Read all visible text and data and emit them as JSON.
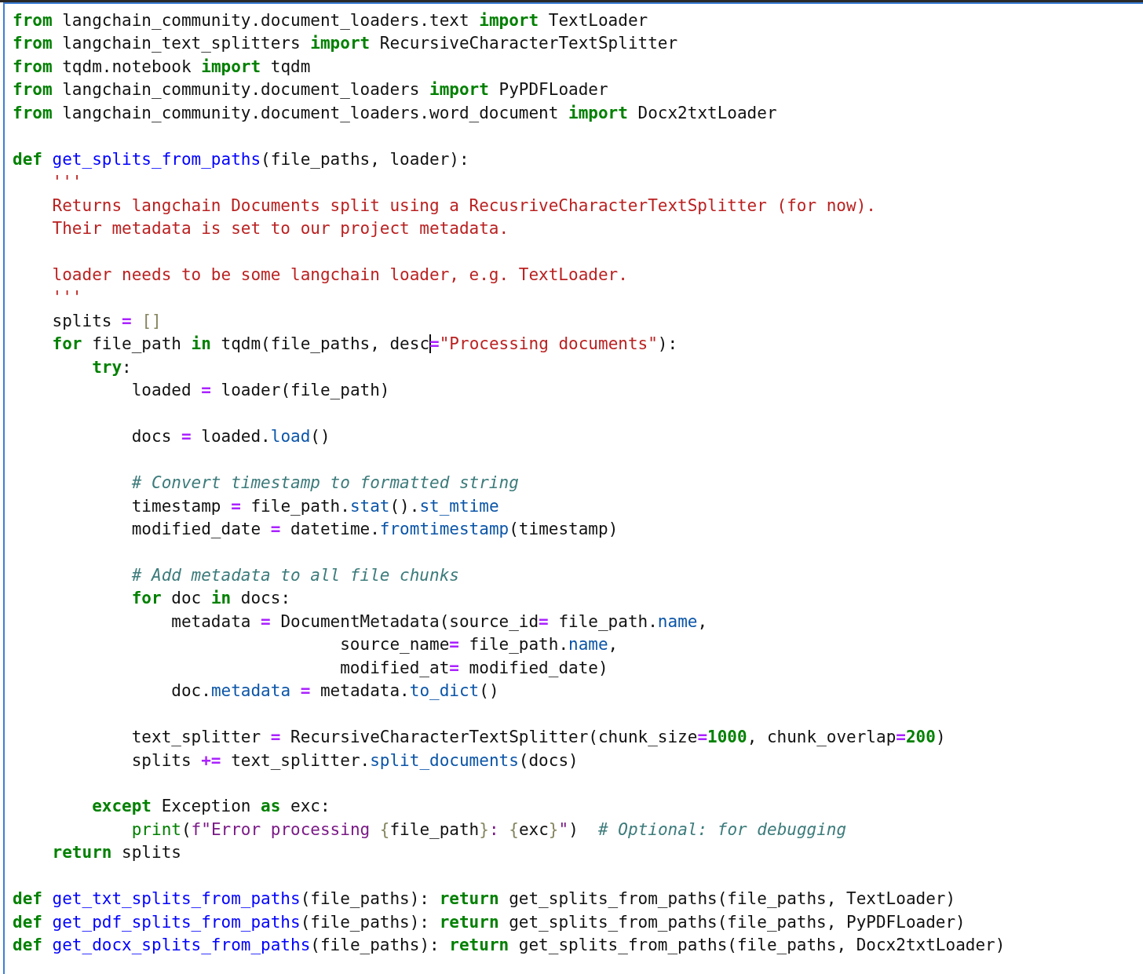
{
  "editor": {
    "lines": [
      {
        "kind": "code",
        "tokens": [
          {
            "kind": "keyword",
            "text": "from"
          },
          {
            "kind": "plain",
            "text": " langchain_community.document_loaders.text "
          },
          {
            "kind": "keyword",
            "text": "import"
          },
          {
            "kind": "plain",
            "text": " TextLoader"
          }
        ]
      },
      {
        "kind": "code",
        "tokens": [
          {
            "kind": "keyword",
            "text": "from"
          },
          {
            "kind": "plain",
            "text": " langchain_text_splitters "
          },
          {
            "kind": "keyword",
            "text": "import"
          },
          {
            "kind": "plain",
            "text": " RecursiveCharacterTextSplitter"
          }
        ]
      },
      {
        "kind": "code",
        "tokens": [
          {
            "kind": "keyword",
            "text": "from"
          },
          {
            "kind": "plain",
            "text": " tqdm.notebook "
          },
          {
            "kind": "keyword",
            "text": "import"
          },
          {
            "kind": "plain",
            "text": " tqdm"
          }
        ]
      },
      {
        "kind": "code",
        "tokens": [
          {
            "kind": "keyword",
            "text": "from"
          },
          {
            "kind": "plain",
            "text": " langchain_community.document_loaders "
          },
          {
            "kind": "keyword",
            "text": "import"
          },
          {
            "kind": "plain",
            "text": " PyPDFLoader"
          }
        ]
      },
      {
        "kind": "code",
        "tokens": [
          {
            "kind": "keyword",
            "text": "from"
          },
          {
            "kind": "plain",
            "text": " langchain_community.document_loaders.word_document "
          },
          {
            "kind": "keyword",
            "text": "import"
          },
          {
            "kind": "plain",
            "text": " Docx2txtLoader"
          }
        ]
      },
      {
        "kind": "blank"
      },
      {
        "kind": "code",
        "tokens": [
          {
            "kind": "keyword",
            "text": "def "
          },
          {
            "kind": "function",
            "text": "get_splits_from_paths"
          },
          {
            "kind": "plain",
            "text": "(file_paths, loader):"
          }
        ]
      },
      {
        "kind": "code",
        "tokens": [
          {
            "kind": "string",
            "text": "    '''"
          }
        ]
      },
      {
        "kind": "code",
        "tokens": [
          {
            "kind": "string",
            "text": "    Returns langchain Documents split using a RecusriveCharacterTextSplitter (for now)."
          }
        ]
      },
      {
        "kind": "code",
        "tokens": [
          {
            "kind": "string",
            "text": "    Their metadata is set to our project metadata."
          }
        ]
      },
      {
        "kind": "blank"
      },
      {
        "kind": "code",
        "tokens": [
          {
            "kind": "string",
            "text": "    loader needs to be some langchain loader, e.g. TextLoader."
          }
        ]
      },
      {
        "kind": "code",
        "tokens": [
          {
            "kind": "string",
            "text": "    '''"
          }
        ]
      },
      {
        "kind": "code",
        "tokens": [
          {
            "kind": "plain",
            "text": "    splits "
          },
          {
            "kind": "operator",
            "text": "="
          },
          {
            "kind": "bracket",
            "text": " []"
          }
        ]
      },
      {
        "kind": "code",
        "tokens": [
          {
            "kind": "keyword",
            "text": "    for"
          },
          {
            "kind": "plain",
            "text": " file_path "
          },
          {
            "kind": "keyword",
            "text": "in"
          },
          {
            "kind": "plain",
            "text": " tqdm(file_paths, desc"
          },
          {
            "kind": "cursor"
          },
          {
            "kind": "operator",
            "text": "="
          },
          {
            "kind": "string",
            "text": "\"Processing documents\""
          },
          {
            "kind": "plain",
            "text": "):"
          }
        ]
      },
      {
        "kind": "code",
        "tokens": [
          {
            "kind": "keyword",
            "text": "        try"
          },
          {
            "kind": "plain",
            "text": ":"
          }
        ]
      },
      {
        "kind": "code",
        "tokens": [
          {
            "kind": "plain",
            "text": "            loaded "
          },
          {
            "kind": "operator",
            "text": "="
          },
          {
            "kind": "plain",
            "text": " loader(file_path)"
          }
        ]
      },
      {
        "kind": "blank"
      },
      {
        "kind": "code",
        "tokens": [
          {
            "kind": "plain",
            "text": "            docs "
          },
          {
            "kind": "operator",
            "text": "="
          },
          {
            "kind": "plain",
            "text": " loaded."
          },
          {
            "kind": "attribute",
            "text": "load"
          },
          {
            "kind": "plain",
            "text": "()"
          }
        ]
      },
      {
        "kind": "blank"
      },
      {
        "kind": "code",
        "tokens": [
          {
            "kind": "comment",
            "text": "            # Convert timestamp to formatted string"
          }
        ]
      },
      {
        "kind": "code",
        "tokens": [
          {
            "kind": "plain",
            "text": "            timestamp "
          },
          {
            "kind": "operator",
            "text": "="
          },
          {
            "kind": "plain",
            "text": " file_path."
          },
          {
            "kind": "attribute",
            "text": "stat"
          },
          {
            "kind": "plain",
            "text": "()."
          },
          {
            "kind": "attribute",
            "text": "st_mtime"
          }
        ]
      },
      {
        "kind": "code",
        "tokens": [
          {
            "kind": "plain",
            "text": "            modified_date "
          },
          {
            "kind": "operator",
            "text": "="
          },
          {
            "kind": "plain",
            "text": " datetime."
          },
          {
            "kind": "attribute",
            "text": "fromtimestamp"
          },
          {
            "kind": "plain",
            "text": "(timestamp)"
          }
        ]
      },
      {
        "kind": "blank"
      },
      {
        "kind": "code",
        "tokens": [
          {
            "kind": "comment",
            "text": "            # Add metadata to all file chunks"
          }
        ]
      },
      {
        "kind": "code",
        "tokens": [
          {
            "kind": "keyword",
            "text": "            for"
          },
          {
            "kind": "plain",
            "text": " doc "
          },
          {
            "kind": "keyword",
            "text": "in"
          },
          {
            "kind": "plain",
            "text": " docs:"
          }
        ]
      },
      {
        "kind": "code",
        "tokens": [
          {
            "kind": "plain",
            "text": "                metadata "
          },
          {
            "kind": "operator",
            "text": "="
          },
          {
            "kind": "plain",
            "text": " DocumentMetadata(source_id"
          },
          {
            "kind": "operator",
            "text": "="
          },
          {
            "kind": "plain",
            "text": " file_path."
          },
          {
            "kind": "attribute",
            "text": "name"
          },
          {
            "kind": "plain",
            "text": ","
          }
        ]
      },
      {
        "kind": "code",
        "tokens": [
          {
            "kind": "plain",
            "text": "                                 source_name"
          },
          {
            "kind": "operator",
            "text": "="
          },
          {
            "kind": "plain",
            "text": " file_path."
          },
          {
            "kind": "attribute",
            "text": "name"
          },
          {
            "kind": "plain",
            "text": ","
          }
        ]
      },
      {
        "kind": "code",
        "tokens": [
          {
            "kind": "plain",
            "text": "                                 modified_at"
          },
          {
            "kind": "operator",
            "text": "="
          },
          {
            "kind": "plain",
            "text": " modified_date)"
          }
        ]
      },
      {
        "kind": "code",
        "tokens": [
          {
            "kind": "plain",
            "text": "                doc."
          },
          {
            "kind": "attribute",
            "text": "metadata"
          },
          {
            "kind": "operator",
            "text": " ="
          },
          {
            "kind": "plain",
            "text": " metadata."
          },
          {
            "kind": "attribute",
            "text": "to_dict"
          },
          {
            "kind": "plain",
            "text": "()"
          }
        ]
      },
      {
        "kind": "blank"
      },
      {
        "kind": "code",
        "tokens": [
          {
            "kind": "plain",
            "text": "            text_splitter "
          },
          {
            "kind": "operator",
            "text": "="
          },
          {
            "kind": "plain",
            "text": " RecursiveCharacterTextSplitter(chunk_size"
          },
          {
            "kind": "operator",
            "text": "="
          },
          {
            "kind": "number",
            "text": "1000"
          },
          {
            "kind": "plain",
            "text": ", chunk_overlap"
          },
          {
            "kind": "operator",
            "text": "="
          },
          {
            "kind": "number",
            "text": "200"
          },
          {
            "kind": "plain",
            "text": ")"
          }
        ]
      },
      {
        "kind": "code",
        "tokens": [
          {
            "kind": "plain",
            "text": "            splits "
          },
          {
            "kind": "operator",
            "text": "+="
          },
          {
            "kind": "plain",
            "text": " text_splitter."
          },
          {
            "kind": "attribute",
            "text": "split_documents"
          },
          {
            "kind": "plain",
            "text": "(docs)"
          }
        ]
      },
      {
        "kind": "blank"
      },
      {
        "kind": "code",
        "tokens": [
          {
            "kind": "keyword",
            "text": "        except"
          },
          {
            "kind": "plain",
            "text": " Exception "
          },
          {
            "kind": "keyword",
            "text": "as"
          },
          {
            "kind": "plain",
            "text": " exc:"
          }
        ]
      },
      {
        "kind": "code",
        "tokens": [
          {
            "kind": "builtin",
            "text": "            print"
          },
          {
            "kind": "plain",
            "text": "("
          },
          {
            "kind": "fstring",
            "text": "f\"Error processing "
          },
          {
            "kind": "bracket",
            "text": "{"
          },
          {
            "kind": "plain",
            "text": "file_path"
          },
          {
            "kind": "bracket",
            "text": "}"
          },
          {
            "kind": "fstring",
            "text": ": "
          },
          {
            "kind": "bracket",
            "text": "{"
          },
          {
            "kind": "plain",
            "text": "exc"
          },
          {
            "kind": "bracket",
            "text": "}"
          },
          {
            "kind": "fstring",
            "text": "\""
          },
          {
            "kind": "plain",
            "text": ")"
          },
          {
            "kind": "comment",
            "text": "  # Optional: for debugging"
          }
        ]
      },
      {
        "kind": "code",
        "tokens": [
          {
            "kind": "keyword",
            "text": "    return"
          },
          {
            "kind": "plain",
            "text": " splits"
          }
        ]
      },
      {
        "kind": "blank"
      },
      {
        "kind": "code",
        "tokens": [
          {
            "kind": "keyword",
            "text": "def "
          },
          {
            "kind": "function",
            "text": "get_txt_splits_from_paths"
          },
          {
            "kind": "plain",
            "text": "(file_paths): "
          },
          {
            "kind": "keyword",
            "text": "return"
          },
          {
            "kind": "plain",
            "text": " get_splits_from_paths(file_paths, TextLoader)"
          }
        ]
      },
      {
        "kind": "code",
        "tokens": [
          {
            "kind": "keyword",
            "text": "def "
          },
          {
            "kind": "function",
            "text": "get_pdf_splits_from_paths"
          },
          {
            "kind": "plain",
            "text": "(file_paths): "
          },
          {
            "kind": "keyword",
            "text": "return"
          },
          {
            "kind": "plain",
            "text": " get_splits_from_paths(file_paths, PyPDFLoader)"
          }
        ]
      },
      {
        "kind": "code",
        "tokens": [
          {
            "kind": "keyword",
            "text": "def "
          },
          {
            "kind": "function",
            "text": "get_docx_splits_from_paths"
          },
          {
            "kind": "plain",
            "text": "(file_paths): "
          },
          {
            "kind": "keyword",
            "text": "return"
          },
          {
            "kind": "plain",
            "text": " get_splits_from_paths(file_paths, Docx2txtLoader)"
          }
        ]
      }
    ]
  }
}
